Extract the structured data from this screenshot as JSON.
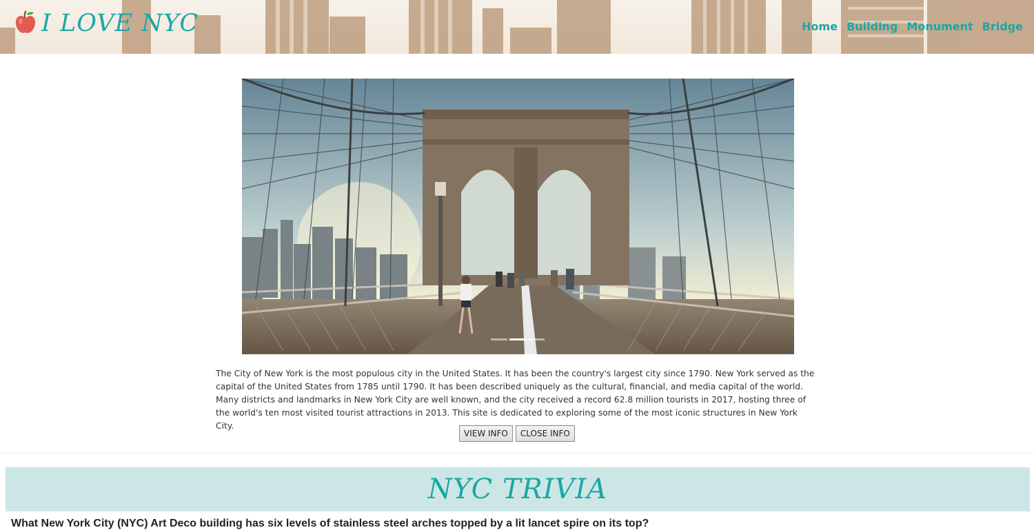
{
  "header": {
    "brand": "I LOVE NYC",
    "logo_icon": "apple-icon",
    "nav": [
      "Home",
      "Building",
      "Monument",
      "Bridge"
    ]
  },
  "hero": {
    "image": "brooklyn-bridge-photo",
    "indicator_count": 3,
    "active_indicator": 2
  },
  "description": "The City of New York is the most populous city in the United States. It has been the country's largest city since 1790. New York served as the capital of the United States from 1785 until 1790. It has been described uniquely as the cultural, financial, and media capital of the world. Many districts and landmarks in New York City are well known, and the city received a record 62.8 million tourists in 2017, hosting three of the world's ten most visited tourist attractions in 2013. This site is dedicated to exploring some of the most iconic structures in New York City.",
  "buttons": {
    "view": "VIEW INFO",
    "close": "CLOSE INFO"
  },
  "trivia": {
    "title": "NYC TRIVIA",
    "question": "What New York City (NYC) Art Deco building has six levels of stainless steel arches topped by a lit lancet spire on its top?"
  },
  "colors": {
    "accent": "#1aa7a6",
    "banner": "#cce6e6"
  }
}
